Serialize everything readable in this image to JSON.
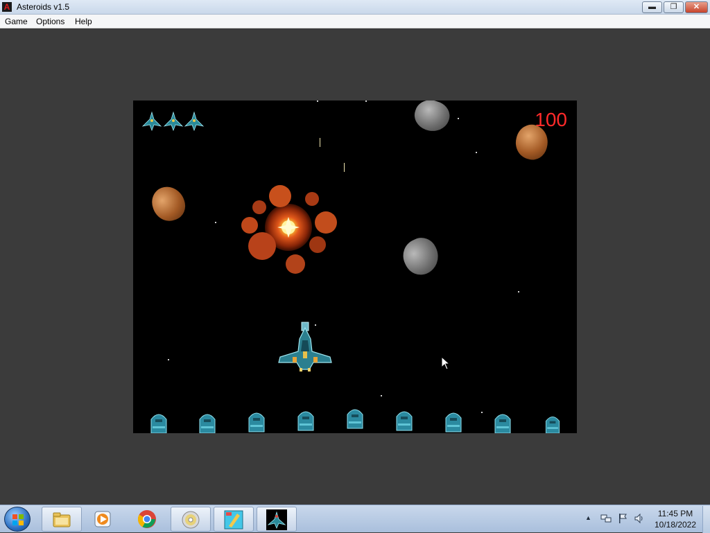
{
  "window": {
    "title": "Asteroids v1.5",
    "icon_letter": "A",
    "controls": {
      "minimize": "▬",
      "maximize": "❐",
      "close": "✕"
    }
  },
  "menu": [
    {
      "label": "Game"
    },
    {
      "label": "Options"
    },
    {
      "label": "Help"
    }
  ],
  "game": {
    "score": "100",
    "lives": 3,
    "score_color": "#ff2a2a"
  },
  "taskbar": {
    "buttons": [
      {
        "name": "windows-explorer-icon"
      },
      {
        "name": "media-player-icon"
      },
      {
        "name": "chrome-icon"
      },
      {
        "name": "dvd-icon"
      },
      {
        "name": "paint-app-icon"
      },
      {
        "name": "asteroids-app-icon"
      }
    ],
    "tray": {
      "arrow": "▲",
      "time": "11:45 PM",
      "date": "10/18/2022"
    }
  }
}
